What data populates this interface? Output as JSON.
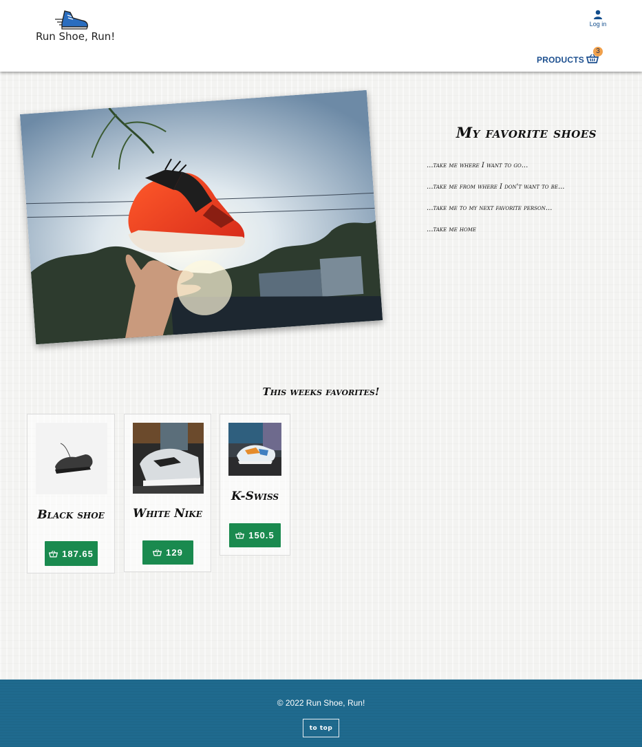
{
  "header": {
    "brand_name": "Run Shoe, Run!",
    "login_label": "Log in",
    "products_label": "PRODUCTS",
    "cart_count": "3"
  },
  "hero": {
    "title": "My favorite shoes",
    "lines": [
      "...take me where I want to go...",
      "...take me from where I don't want to be...",
      "...take me to my next favorite person...",
      "...take me home"
    ]
  },
  "favorites": {
    "title": "This weeks favorites!",
    "items": [
      {
        "name": "Black shoe",
        "price": "187.65"
      },
      {
        "name": "White Nike",
        "price": "129"
      },
      {
        "name": "K-Swiss",
        "price": "150.5"
      }
    ]
  },
  "footer": {
    "copyright": "© 2022 Run Shoe, Run!",
    "to_top_label": "to top"
  },
  "colors": {
    "brand_blue": "#1c4f8f",
    "price_green": "#1a8a4f",
    "badge_orange": "#f0a04b",
    "footer_blue": "#1f6a8e"
  }
}
